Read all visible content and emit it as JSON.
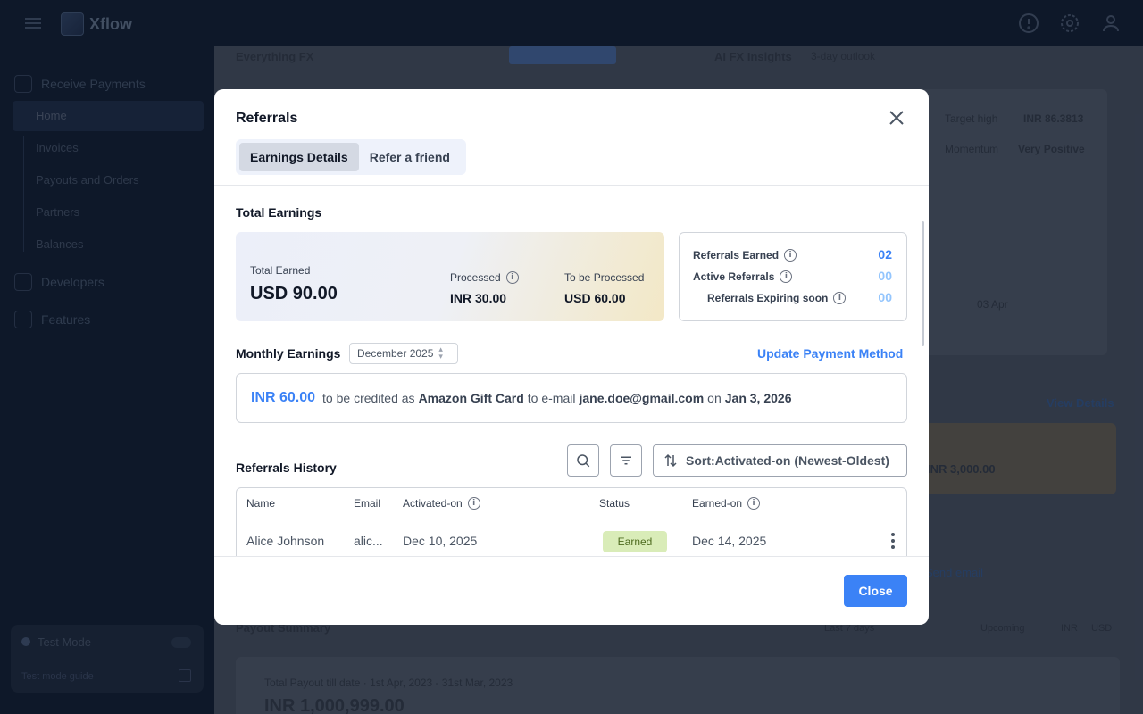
{
  "app": {
    "name": "Xflow"
  },
  "sidebar": {
    "receive_payments": "Receive Payments",
    "items": [
      "Home",
      "Invoices",
      "Payouts and Orders",
      "Partners",
      "Balances"
    ],
    "developers": "Developers",
    "features": "Features",
    "test_mode": "Test Mode",
    "test_mode_guide": "Test mode guide"
  },
  "background": {
    "everything_fx": "Everything FX",
    "ai_fx_insights": "AI FX Insights",
    "outlook": "3-day outlook",
    "target_high_label": "Target high",
    "target_high_value": "INR 86.3813",
    "momentum_label": "Momentum",
    "momentum_value": "Very Positive",
    "date_tick": "03 Apr",
    "view_details": "View Details",
    "payout_summary": "Payout Summary",
    "refer_amount": "INR 3,000.00",
    "send_email": "Send email",
    "last7": "Last 7 days",
    "upcoming": "Upcoming",
    "inr": "INR",
    "usd": "USD",
    "total_payout": "Total Payout till date",
    "total_payout_range": "1st Apr, 2023 - 31st Mar, 2023",
    "total_payout_value": "INR 1,000,999.00"
  },
  "modal": {
    "title": "Referrals",
    "tabs": [
      "Earnings Details",
      "Refer a friend"
    ],
    "total_earnings_title": "Total Earnings",
    "total_earned_label": "Total Earned",
    "total_earned_value": "USD 90.00",
    "processed_label": "Processed",
    "processed_value": "INR 30.00",
    "to_be_processed_label": "To be Processed",
    "to_be_processed_value": "USD 60.00",
    "referrals_earned_label": "Referrals Earned",
    "referrals_earned_value": "02",
    "active_referrals_label": "Active Referrals",
    "active_referrals_value": "00",
    "expiring_label": "Referrals Expiring soon",
    "expiring_value": "00",
    "monthly_earnings_title": "Monthly Earnings",
    "month_selected": "December 2025",
    "update_payment": "Update Payment Method",
    "credit": {
      "amount": "INR 60.00",
      "text1": "to be credited as",
      "method": "Amazon Gift Card",
      "text2": "to e-mail",
      "email": "jane.doe@gmail.com",
      "text3": "on",
      "date": "Jan 3, 2026"
    },
    "history_title": "Referrals History",
    "sort_label": "Sort:Activated-on (Newest-Oldest)",
    "columns": [
      "Name",
      "Email",
      "Activated-on",
      "Status",
      "Earned-on"
    ],
    "rows": [
      {
        "name": "Alice Johnson",
        "email": "alic...",
        "activated": "Dec 10, 2025",
        "status": "Earned",
        "earned": "Dec 14, 2025"
      }
    ],
    "close_label": "Close"
  },
  "colors": {
    "accent": "#3b82f6",
    "earned_badge": "#d9ecb8",
    "sidebar_bg": "#0f1b2e"
  }
}
